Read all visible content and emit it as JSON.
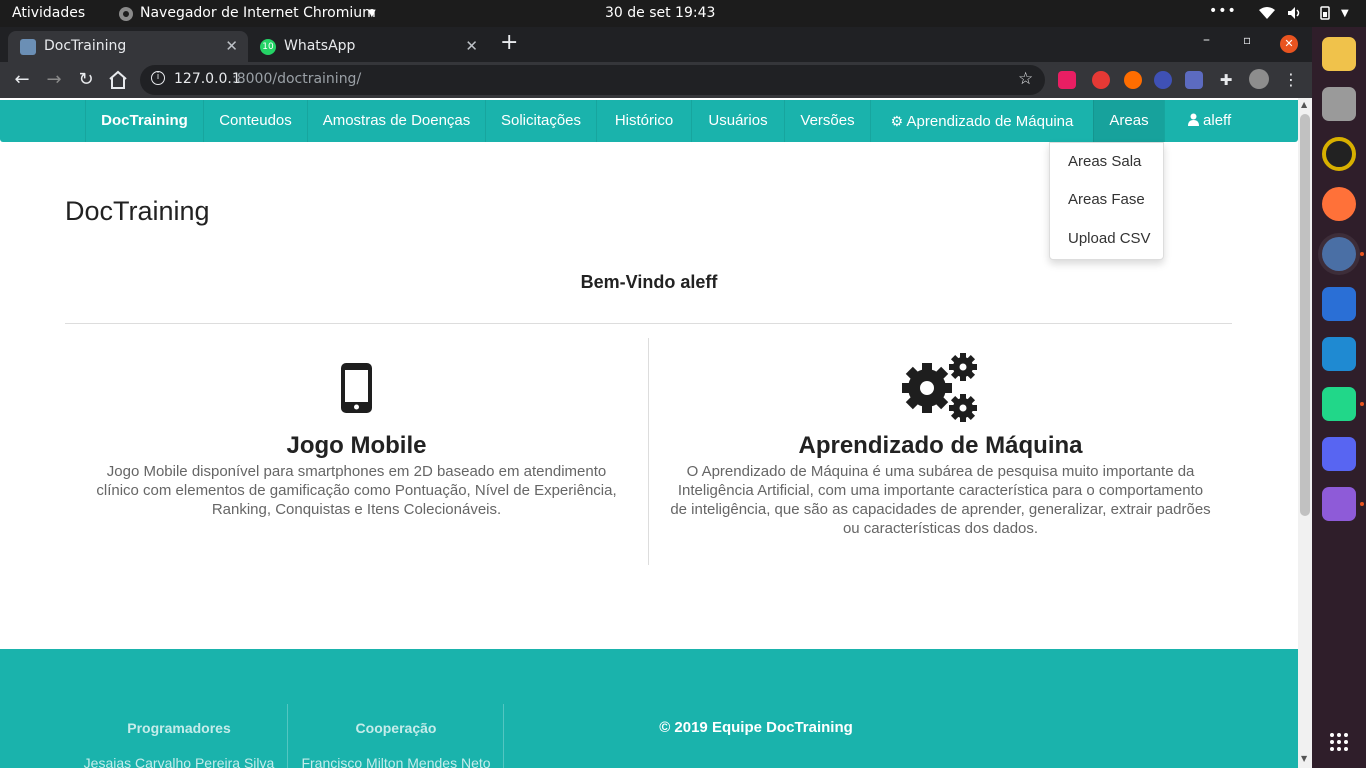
{
  "os": {
    "activities": "Atividades",
    "app_menu": "Navegador de Internet Chromium",
    "clock": "30 de set  19:43"
  },
  "browser": {
    "tabs": [
      {
        "title": "DocTraining",
        "active": true
      },
      {
        "title": "WhatsApp",
        "badge": "10",
        "active": false
      }
    ],
    "url_host": "127.0.0.1",
    "url_rest": ":8000/doctraining/"
  },
  "navbar": {
    "brand": "DocTraining",
    "items": [
      "Conteudos",
      "Amostras de Doenças",
      "Solicitações",
      "Histórico",
      "Usuários",
      "Versões",
      "Aprendizado de Máquina",
      "Areas"
    ],
    "user": "aleff"
  },
  "dropdown": {
    "items": [
      "Areas Sala",
      "Areas Fase",
      "Upload CSV"
    ]
  },
  "page": {
    "title": "DocTraining",
    "welcome": "Bem-Vindo aleff",
    "features": [
      {
        "icon": "mobile-phone-icon",
        "title": "Jogo Mobile",
        "text": "Jogo Mobile disponível para smartphones em 2D baseado em atendimento clínico com elementos de gamificação como Pontuação, Nível de Experiência, Ranking, Conquistas e Itens Colecionáveis."
      },
      {
        "icon": "gears-icon",
        "title": "Aprendizado de Máquina",
        "text": "O Aprendizado de Máquina é uma subárea de pesquisa muito importante da Inteligência Artificial, com uma importante característica para o comportamento de inteligência, que são as capacidades de aprender, generalizar, extrair padrões ou características dos dados."
      }
    ]
  },
  "footer": {
    "programmers_label": "Programadores",
    "programmers_first": "Jesaias Carvalho Pereira Silva",
    "cooperation_label": "Cooperação",
    "cooperation_first": "Francisco Milton Mendes Neto",
    "copyright": "© 2019 Equipe DocTraining"
  },
  "colors": {
    "accent": "#1ab3ac",
    "accent_dark": "#17a29c"
  }
}
